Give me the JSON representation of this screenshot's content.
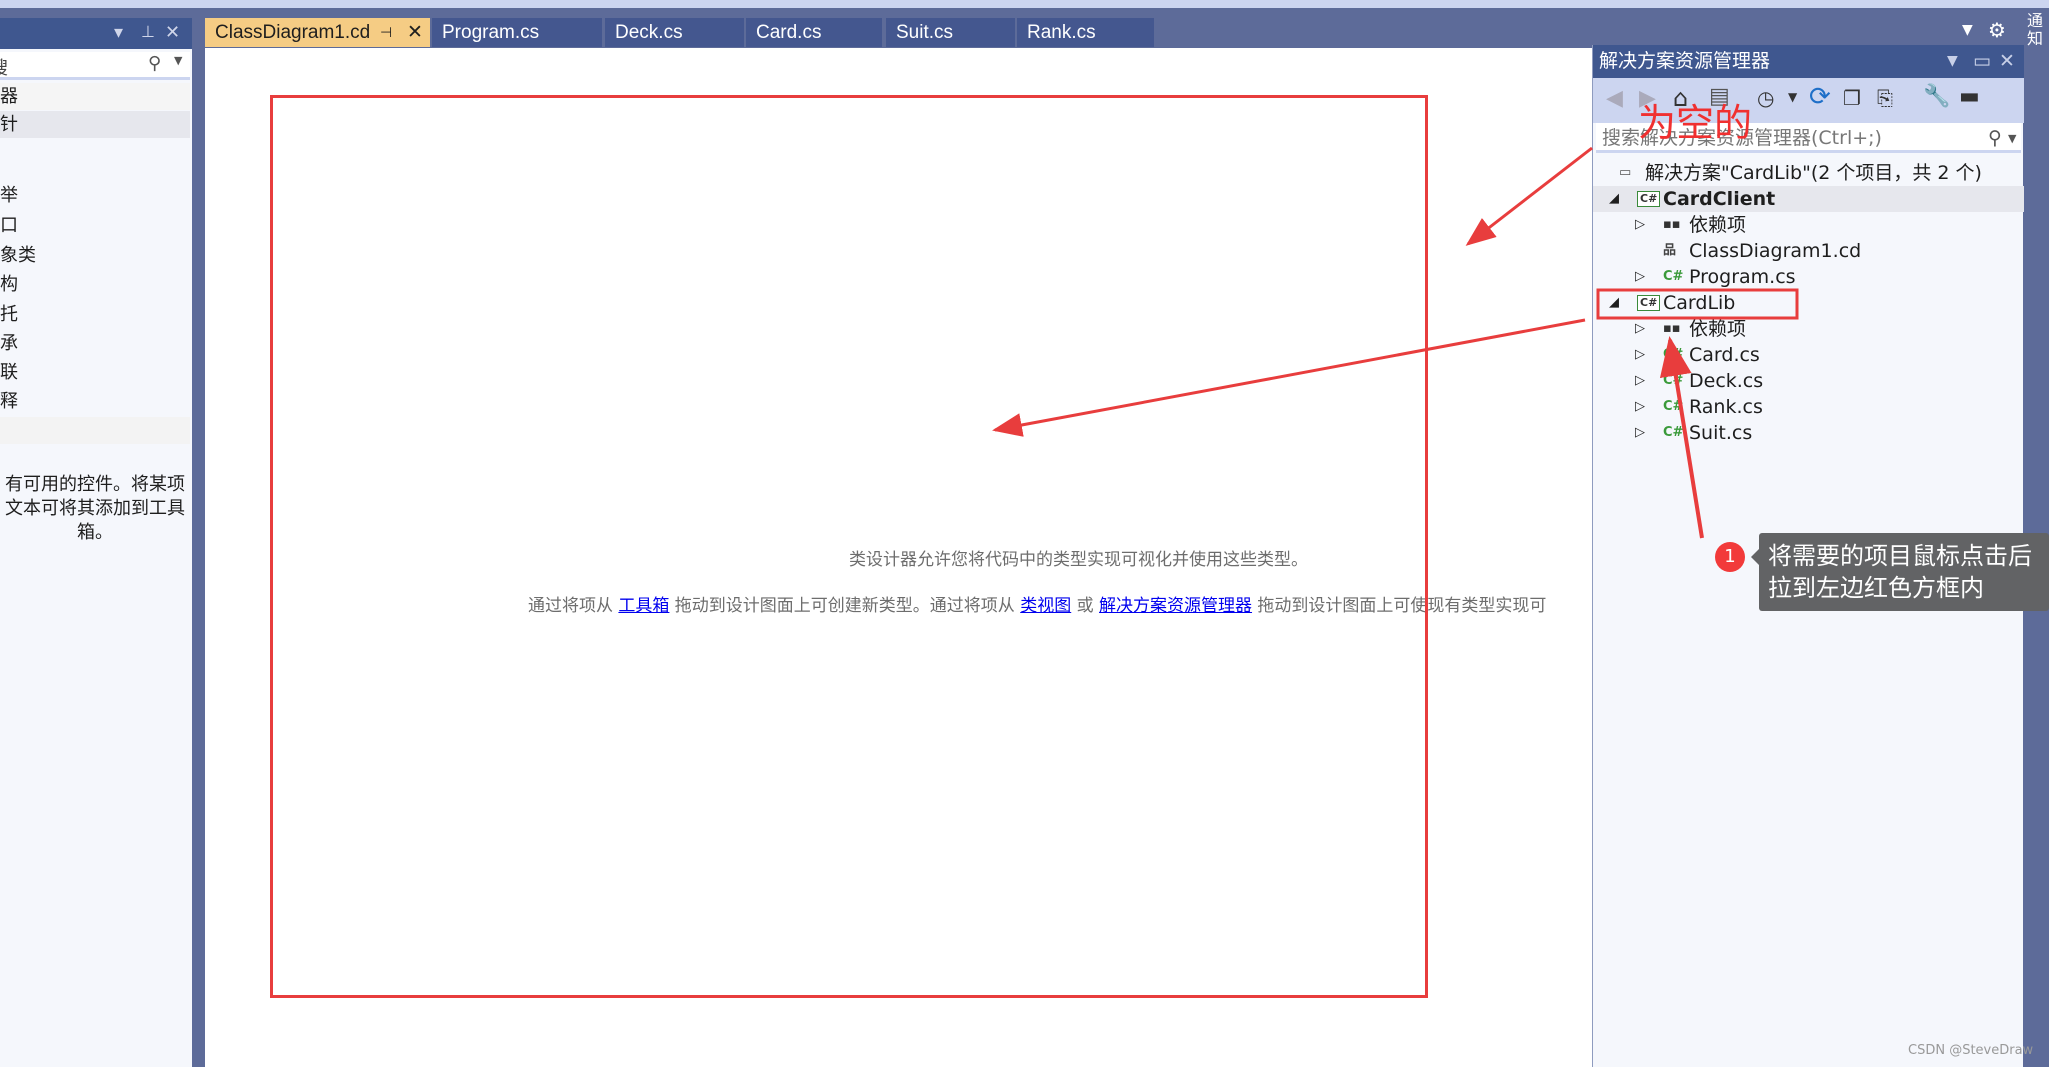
{
  "toolbox": {
    "search_value": "搜",
    "items": [
      "器",
      "针",
      "举",
      "口",
      "象类",
      "构",
      "托",
      "承",
      "联",
      "释"
    ],
    "help_text": [
      "有可用的控件。将某项",
      "文本可将其添加到工具",
      "箱。"
    ]
  },
  "tabs": [
    {
      "label": "ClassDiagram1.cd",
      "active": true
    },
    {
      "label": "Program.cs"
    },
    {
      "label": "Deck.cs"
    },
    {
      "label": "Card.cs"
    },
    {
      "label": "Suit.cs"
    },
    {
      "label": "Rank.cs"
    }
  ],
  "designer": {
    "line1": "类设计器允许您将代码中的类型实现可视化并使用这些类型。",
    "line2_a": "通过将项从 ",
    "link_toolbox": "工具箱",
    "line2_b": " 拖动到设计图面上可创建新类型。通过将项从 ",
    "link_classview": "类视图",
    "line2_c": " 或 ",
    "link_solution": "解决方案资源管理器",
    "line2_d": " 拖动到设计图面上可使现有类型实现可"
  },
  "solution_explorer": {
    "title": "解决方案资源管理器",
    "search_placeholder": "搜索解决方案资源管理器(Ctrl+;)",
    "tree": [
      {
        "label": "解决方案\"CardLib\"(2 个项目，共 2 个)",
        "level": 0,
        "icon": "solution-icon"
      },
      {
        "label": "CardClient",
        "level": 0,
        "icon": "csharp-project-icon",
        "expanded": true,
        "selected": true,
        "bold": true
      },
      {
        "label": "依赖项",
        "level": 1,
        "icon": "dependencies-icon",
        "collapsed": true
      },
      {
        "label": "ClassDiagram1.cd",
        "level": 1,
        "icon": "class-diagram-icon"
      },
      {
        "label": "Program.cs",
        "level": 1,
        "icon": "csharp-file-icon",
        "collapsed": true
      },
      {
        "label": "CardLib",
        "level": 0,
        "icon": "csharp-project-icon",
        "expanded": true
      },
      {
        "label": "依赖项",
        "level": 1,
        "icon": "dependencies-icon",
        "collapsed": true
      },
      {
        "label": "Card.cs",
        "level": 1,
        "icon": "csharp-file-icon",
        "collapsed": true
      },
      {
        "label": "Deck.cs",
        "level": 1,
        "icon": "csharp-file-icon",
        "collapsed": true
      },
      {
        "label": "Rank.cs",
        "level": 1,
        "icon": "csharp-file-icon",
        "collapsed": true
      },
      {
        "label": "Suit.cs",
        "level": 1,
        "icon": "csharp-file-icon",
        "collapsed": true
      }
    ]
  },
  "notifications_label": "通知",
  "annotations": {
    "empty_label": "为空的",
    "step_number": "1",
    "instruction_line1": "将需要的项目鼠标点击后",
    "instruction_line2": "拉到左边红色方框内",
    "color": "#e83d3d"
  },
  "watermark": "CSDN @SteveDraw"
}
